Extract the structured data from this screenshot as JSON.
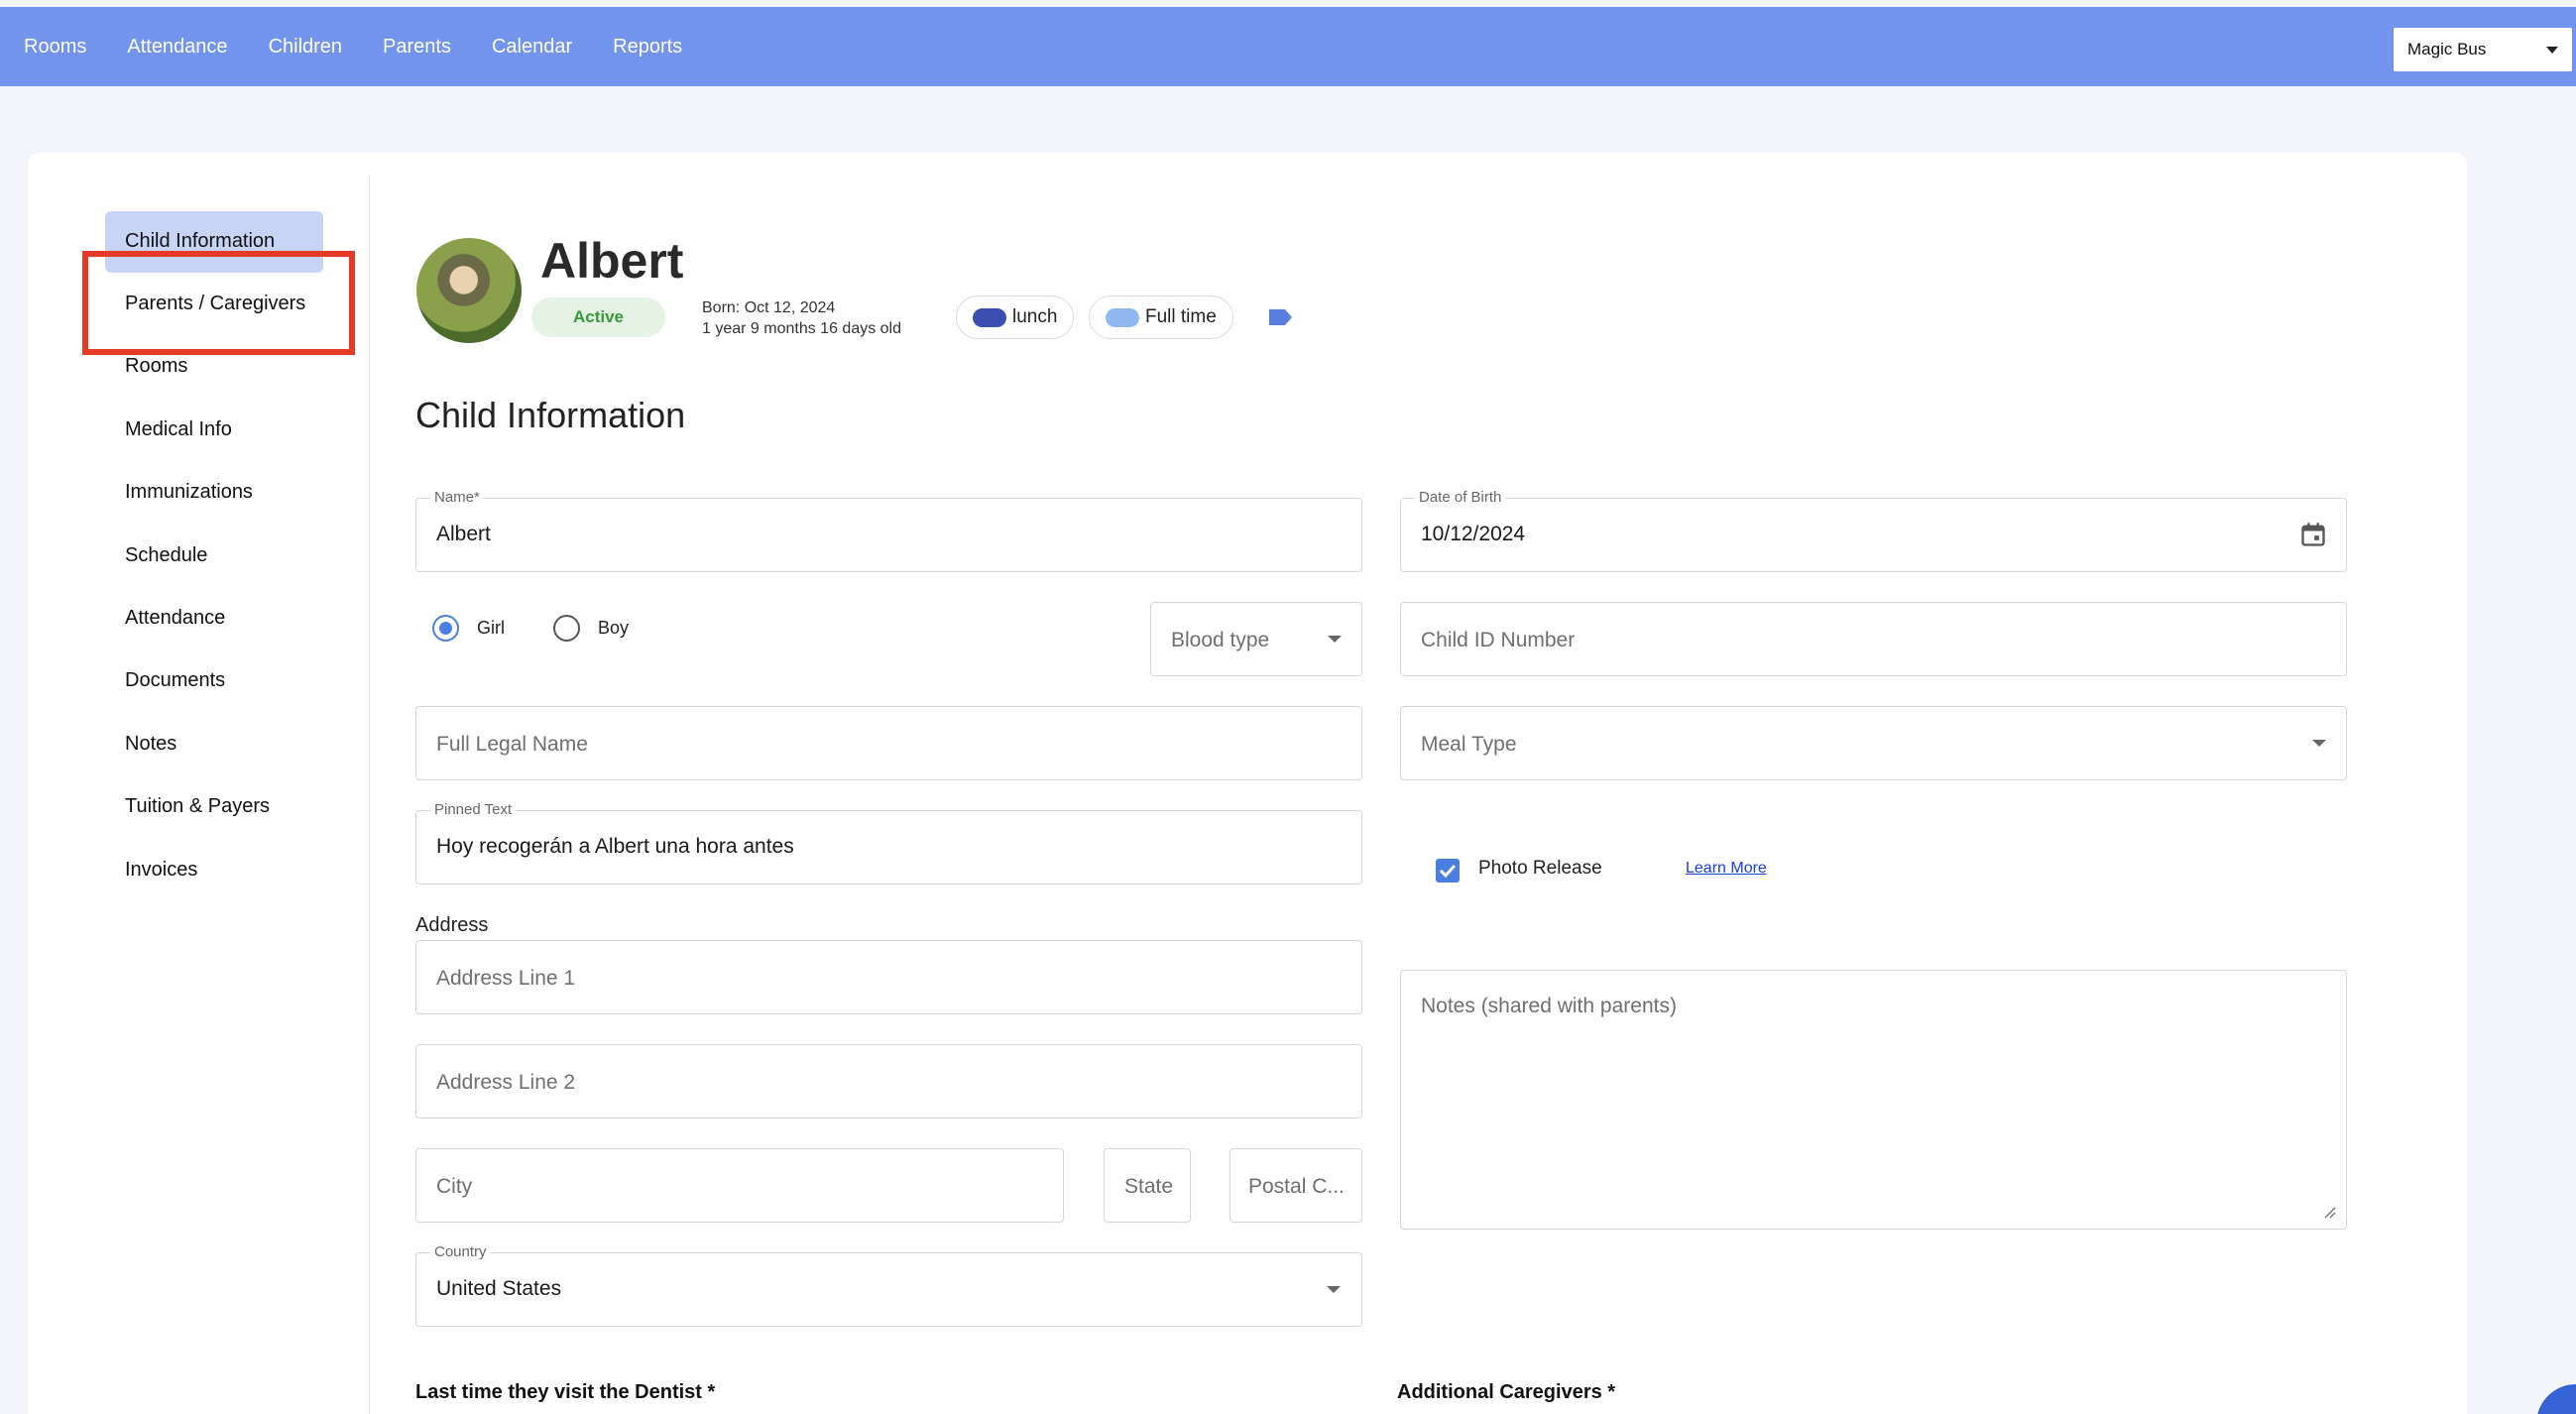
{
  "topnav": {
    "items": [
      "Rooms",
      "Attendance",
      "Children",
      "Parents",
      "Calendar",
      "Reports"
    ],
    "org_selector": "Magic Bus"
  },
  "sidebar": {
    "items": [
      {
        "label": "Child Information",
        "active": true
      },
      {
        "label": "Parents / Caregivers",
        "highlighted": true
      },
      {
        "label": "Rooms"
      },
      {
        "label": "Medical Info"
      },
      {
        "label": "Immunizations"
      },
      {
        "label": "Schedule"
      },
      {
        "label": "Attendance"
      },
      {
        "label": "Documents"
      },
      {
        "label": "Notes"
      },
      {
        "label": "Tuition & Payers"
      },
      {
        "label": "Invoices"
      }
    ]
  },
  "profile": {
    "name": "Albert",
    "status": "Active",
    "born": "Born: Oct 12, 2024",
    "age": "1 year 9 months 16 days old",
    "tags": [
      {
        "label": "lunch",
        "color": "#3a4fb0"
      },
      {
        "label": "Full time",
        "color": "#8fb8f0"
      }
    ],
    "tag_icon": "label-icon"
  },
  "form": {
    "section_title": "Child Information",
    "name": {
      "label": "Name*",
      "value": "Albert"
    },
    "dob": {
      "label": "Date of Birth",
      "value": "10/12/2024"
    },
    "gender": {
      "options": [
        "Girl",
        "Boy"
      ],
      "selected": "Girl"
    },
    "blood_type": {
      "placeholder": "Blood type"
    },
    "child_id": {
      "placeholder": "Child ID Number"
    },
    "full_legal_name": {
      "placeholder": "Full Legal Name"
    },
    "meal_type": {
      "placeholder": "Meal Type"
    },
    "pinned_text": {
      "label": "Pinned Text",
      "value": "Hoy recogerán a Albert una hora antes"
    },
    "photo_release": {
      "label": "Photo Release",
      "checked": true,
      "link": "Learn More"
    },
    "address": {
      "heading": "Address",
      "line1_placeholder": "Address Line 1",
      "line2_placeholder": "Address Line 2",
      "city_placeholder": "City",
      "state_placeholder": "State",
      "postal_placeholder": "Postal C..."
    },
    "country": {
      "label": "Country",
      "value": "United States"
    },
    "notes": {
      "placeholder": "Notes (shared with parents)"
    },
    "dentist_label": "Last time they visit the Dentist *",
    "caregivers_label": "Additional Caregivers *"
  },
  "colors": {
    "topbar": "#7294ec",
    "accent": "#4a7fe0",
    "active_nav_bg": "#c7d4f5",
    "highlight_border": "#e53a26",
    "status_bg": "#e4f3e4",
    "status_text": "#3a9a3a"
  }
}
